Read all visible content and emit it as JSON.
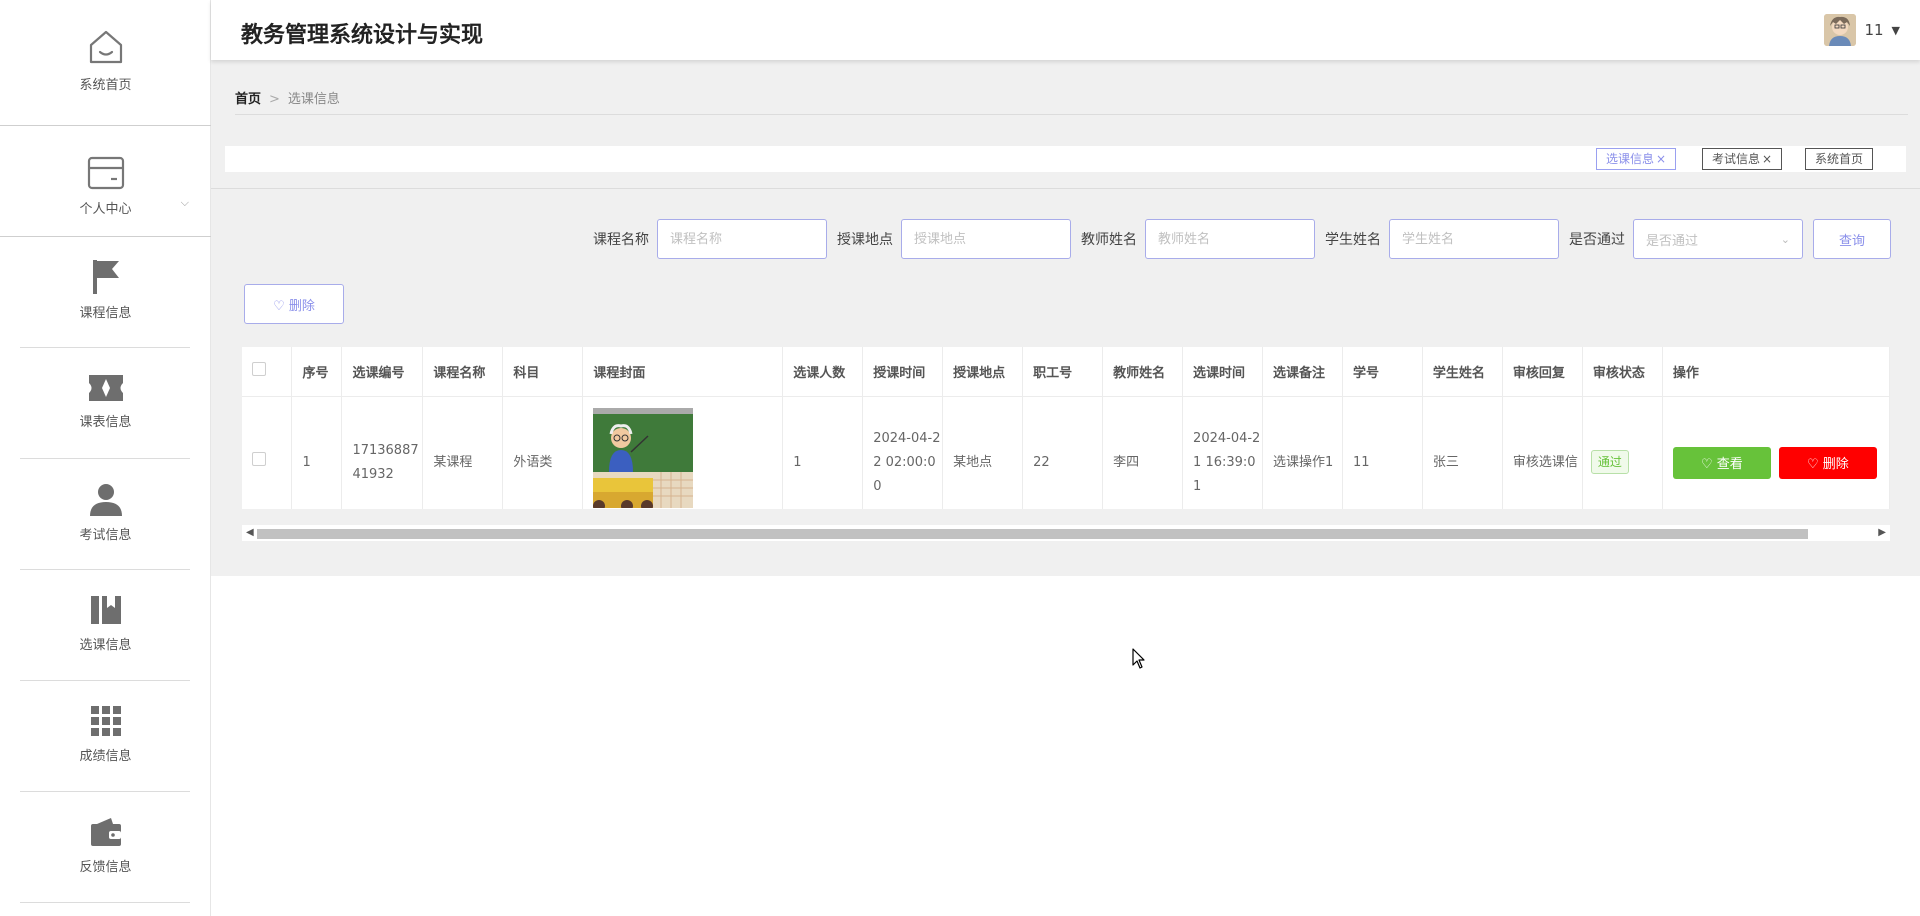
{
  "header": {
    "title": "教务管理系统设计与实现",
    "user": "11"
  },
  "sidebar": {
    "items": [
      {
        "label": "系统首页",
        "icon": "home-icon"
      },
      {
        "label": "个人中心",
        "icon": "card-icon"
      },
      {
        "label": "课程信息",
        "icon": "flag-icon"
      },
      {
        "label": "课表信息",
        "icon": "ticket-icon"
      },
      {
        "label": "考试信息",
        "icon": "user-icon"
      },
      {
        "label": "选课信息",
        "icon": "bookmark-icon"
      },
      {
        "label": "成绩信息",
        "icon": "grid-icon"
      },
      {
        "label": "反馈信息",
        "icon": "wallet-icon"
      }
    ]
  },
  "breadcrumb": {
    "home": "首页",
    "sep": ">",
    "current": "选课信息"
  },
  "tabs": [
    {
      "label": "选课信息",
      "closable": "×"
    },
    {
      "label": "考试信息",
      "closable": "×"
    },
    {
      "label": "系统首页"
    }
  ],
  "search": {
    "course_name_label": "课程名称",
    "course_name_placeholder": "课程名称",
    "location_label": "授课地点",
    "location_placeholder": "授课地点",
    "teacher_label": "教师姓名",
    "teacher_placeholder": "教师姓名",
    "student_label": "学生姓名",
    "student_placeholder": "学生姓名",
    "pass_label": "是否通过",
    "pass_placeholder": "是否通过",
    "query_button": "查询"
  },
  "toolbar": {
    "delete_button": "删除"
  },
  "table": {
    "headers": [
      "序号",
      "选课编号",
      "课程名称",
      "科目",
      "课程封面",
      "选课人数",
      "授课时间",
      "授课地点",
      "职工号",
      "教师姓名",
      "选课时间",
      "选课备注",
      "学号",
      "学生姓名",
      "审核回复",
      "审核状态",
      "操作"
    ],
    "rows": [
      {
        "index": "1",
        "course_select_no": "1713688741932",
        "course_name": "某课程",
        "subject": "外语类",
        "enroll_count": "1",
        "teach_time": "2024-04-22 02:00:00",
        "location": "某地点",
        "staff_no": "22",
        "teacher_name": "李四",
        "select_time": "2024-04-21 16:39:01",
        "remark": "选课操作1",
        "student_no": "11",
        "student_name": "张三",
        "reply": "审核选课信",
        "status": "通过",
        "view_button": "查看",
        "delete_button": "删除"
      }
    ]
  },
  "colors": {
    "accent": "#8a8fea",
    "success": "#67c23a",
    "danger": "#ff0000"
  }
}
